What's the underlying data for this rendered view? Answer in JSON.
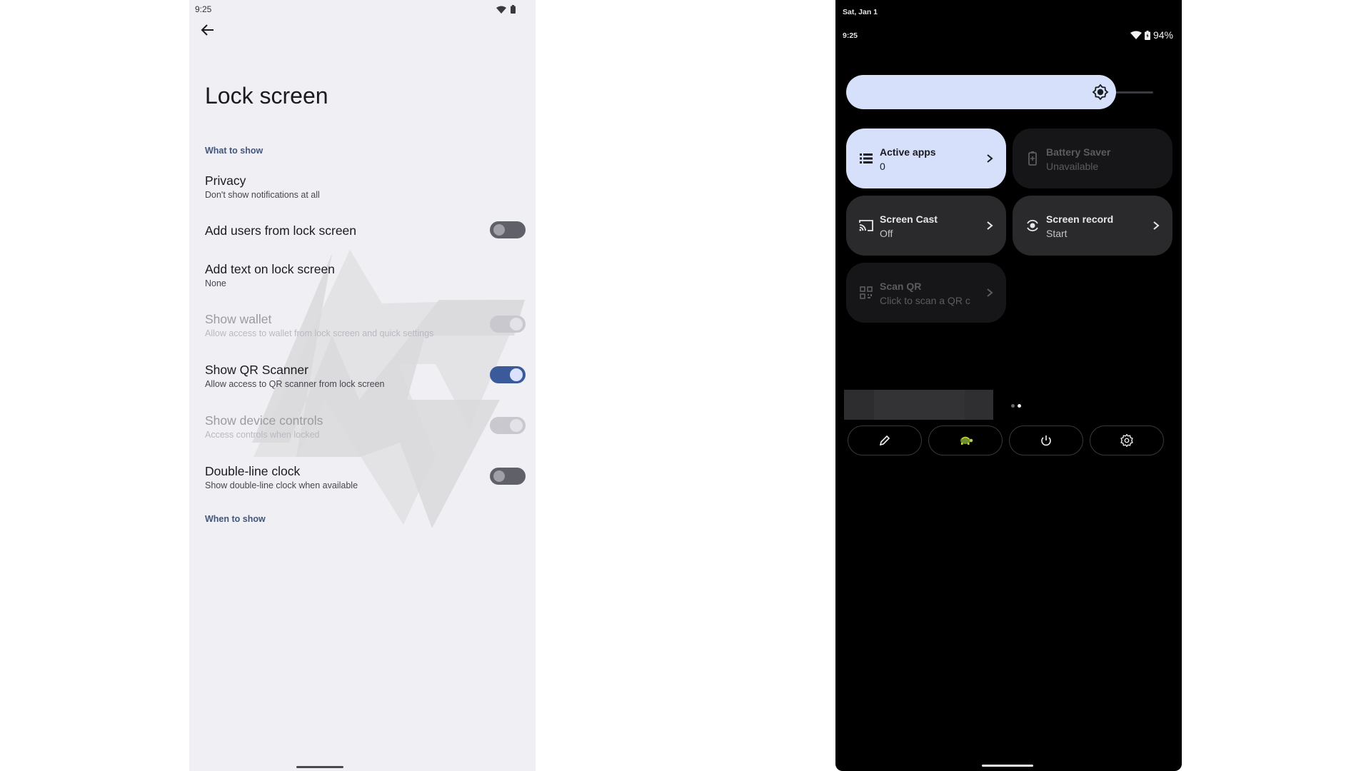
{
  "left_screen": {
    "status_bar": {
      "time": "9:25",
      "icons": [
        "wifi-icon",
        "battery-icon"
      ]
    },
    "back_icon": "arrow-back-icon",
    "title": "Lock screen",
    "sections": [
      {
        "header": "What to show"
      },
      {
        "header": "When to show"
      }
    ],
    "rows": [
      {
        "title": "Privacy",
        "summary": "Don't show notifications at all",
        "has_switch": false,
        "enabled": true
      },
      {
        "title": "Add users from lock screen",
        "summary": "",
        "has_switch": true,
        "checked": false,
        "enabled": true
      },
      {
        "title": "Add text on lock screen",
        "summary": "None",
        "has_switch": false,
        "enabled": true
      },
      {
        "title": "Show wallet",
        "summary": "Allow access to wallet from lock screen and quick settings",
        "has_switch": true,
        "checked": true,
        "enabled": false
      },
      {
        "title": "Show QR Scanner",
        "summary": "Allow access to QR scanner from lock screen",
        "has_switch": true,
        "checked": true,
        "enabled": true
      },
      {
        "title": "Show device controls",
        "summary": "Access controls when locked",
        "has_switch": true,
        "checked": true,
        "enabled": false
      },
      {
        "title": "Double-line clock",
        "summary": "Show double-line clock when available",
        "has_switch": true,
        "checked": false,
        "enabled": true
      }
    ],
    "colors": {
      "background": "#f0f0f4",
      "section_header": "#44557a",
      "switch_on": "#3a5a9a"
    }
  },
  "right_screen": {
    "date": "Sat, Jan 1",
    "time": "9:25",
    "battery_percent": "94%",
    "status_icons": [
      "wifi-icon",
      "battery-charging-icon"
    ],
    "brightness": {
      "level_fraction": 0.88,
      "icon": "brightness-icon"
    },
    "tiles": [
      {
        "label": "Active apps",
        "secondary": "0",
        "icon": "list-icon",
        "state": "active",
        "has_chevron": true
      },
      {
        "label": "Battery Saver",
        "secondary": "Unavailable",
        "icon": "battery-saver-icon",
        "state": "unavailable",
        "has_chevron": false
      },
      {
        "label": "Screen Cast",
        "secondary": "Off",
        "icon": "cast-icon",
        "state": "inactive",
        "has_chevron": true
      },
      {
        "label": "Screen record",
        "secondary": "Start",
        "icon": "screen-record-icon",
        "state": "inactive",
        "has_chevron": true
      },
      {
        "label": "Scan QR",
        "secondary": "Click to scan a QR c",
        "icon": "qr-code-icon",
        "state": "unavailable",
        "has_chevron": true
      }
    ],
    "pager": {
      "pages": 2,
      "current": 2
    },
    "footer_buttons": [
      {
        "name": "edit",
        "icon": "pencil-icon"
      },
      {
        "name": "user-switcher",
        "icon": "turtle-avatar-icon"
      },
      {
        "name": "power",
        "icon": "power-icon"
      },
      {
        "name": "settings",
        "icon": "gear-icon"
      }
    ],
    "colors": {
      "background": "#000000",
      "tile_active": "#d6e0fb",
      "tile_inactive": "#2a2a2d",
      "tile_unavailable": "#161618"
    }
  }
}
